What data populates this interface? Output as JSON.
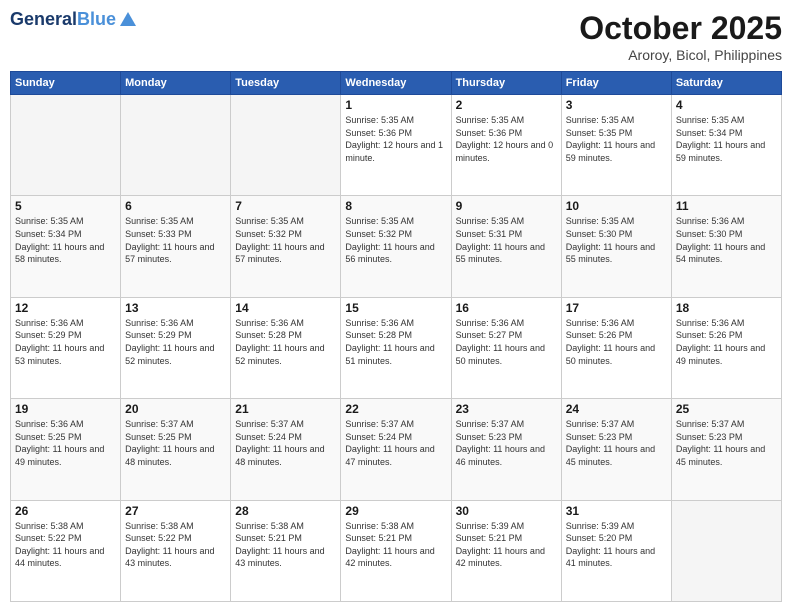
{
  "header": {
    "logo_line1": "General",
    "logo_line2": "Blue",
    "title": "October 2025",
    "subtitle": "Aroroy, Bicol, Philippines"
  },
  "calendar": {
    "days_of_week": [
      "Sunday",
      "Monday",
      "Tuesday",
      "Wednesday",
      "Thursday",
      "Friday",
      "Saturday"
    ],
    "weeks": [
      [
        {
          "day": "",
          "empty": true
        },
        {
          "day": "",
          "empty": true
        },
        {
          "day": "",
          "empty": true
        },
        {
          "day": "1",
          "sunrise": "5:35 AM",
          "sunset": "5:36 PM",
          "daylight": "12 hours and 1 minute."
        },
        {
          "day": "2",
          "sunrise": "5:35 AM",
          "sunset": "5:36 PM",
          "daylight": "12 hours and 0 minutes."
        },
        {
          "day": "3",
          "sunrise": "5:35 AM",
          "sunset": "5:35 PM",
          "daylight": "11 hours and 59 minutes."
        },
        {
          "day": "4",
          "sunrise": "5:35 AM",
          "sunset": "5:34 PM",
          "daylight": "11 hours and 59 minutes."
        }
      ],
      [
        {
          "day": "5",
          "sunrise": "5:35 AM",
          "sunset": "5:34 PM",
          "daylight": "11 hours and 58 minutes."
        },
        {
          "day": "6",
          "sunrise": "5:35 AM",
          "sunset": "5:33 PM",
          "daylight": "11 hours and 57 minutes."
        },
        {
          "day": "7",
          "sunrise": "5:35 AM",
          "sunset": "5:32 PM",
          "daylight": "11 hours and 57 minutes."
        },
        {
          "day": "8",
          "sunrise": "5:35 AM",
          "sunset": "5:32 PM",
          "daylight": "11 hours and 56 minutes."
        },
        {
          "day": "9",
          "sunrise": "5:35 AM",
          "sunset": "5:31 PM",
          "daylight": "11 hours and 55 minutes."
        },
        {
          "day": "10",
          "sunrise": "5:35 AM",
          "sunset": "5:30 PM",
          "daylight": "11 hours and 55 minutes."
        },
        {
          "day": "11",
          "sunrise": "5:36 AM",
          "sunset": "5:30 PM",
          "daylight": "11 hours and 54 minutes."
        }
      ],
      [
        {
          "day": "12",
          "sunrise": "5:36 AM",
          "sunset": "5:29 PM",
          "daylight": "11 hours and 53 minutes."
        },
        {
          "day": "13",
          "sunrise": "5:36 AM",
          "sunset": "5:29 PM",
          "daylight": "11 hours and 52 minutes."
        },
        {
          "day": "14",
          "sunrise": "5:36 AM",
          "sunset": "5:28 PM",
          "daylight": "11 hours and 52 minutes."
        },
        {
          "day": "15",
          "sunrise": "5:36 AM",
          "sunset": "5:28 PM",
          "daylight": "11 hours and 51 minutes."
        },
        {
          "day": "16",
          "sunrise": "5:36 AM",
          "sunset": "5:27 PM",
          "daylight": "11 hours and 50 minutes."
        },
        {
          "day": "17",
          "sunrise": "5:36 AM",
          "sunset": "5:26 PM",
          "daylight": "11 hours and 50 minutes."
        },
        {
          "day": "18",
          "sunrise": "5:36 AM",
          "sunset": "5:26 PM",
          "daylight": "11 hours and 49 minutes."
        }
      ],
      [
        {
          "day": "19",
          "sunrise": "5:36 AM",
          "sunset": "5:25 PM",
          "daylight": "11 hours and 49 minutes."
        },
        {
          "day": "20",
          "sunrise": "5:37 AM",
          "sunset": "5:25 PM",
          "daylight": "11 hours and 48 minutes."
        },
        {
          "day": "21",
          "sunrise": "5:37 AM",
          "sunset": "5:24 PM",
          "daylight": "11 hours and 48 minutes."
        },
        {
          "day": "22",
          "sunrise": "5:37 AM",
          "sunset": "5:24 PM",
          "daylight": "11 hours and 47 minutes."
        },
        {
          "day": "23",
          "sunrise": "5:37 AM",
          "sunset": "5:23 PM",
          "daylight": "11 hours and 46 minutes."
        },
        {
          "day": "24",
          "sunrise": "5:37 AM",
          "sunset": "5:23 PM",
          "daylight": "11 hours and 45 minutes."
        },
        {
          "day": "25",
          "sunrise": "5:37 AM",
          "sunset": "5:23 PM",
          "daylight": "11 hours and 45 minutes."
        }
      ],
      [
        {
          "day": "26",
          "sunrise": "5:38 AM",
          "sunset": "5:22 PM",
          "daylight": "11 hours and 44 minutes."
        },
        {
          "day": "27",
          "sunrise": "5:38 AM",
          "sunset": "5:22 PM",
          "daylight": "11 hours and 43 minutes."
        },
        {
          "day": "28",
          "sunrise": "5:38 AM",
          "sunset": "5:21 PM",
          "daylight": "11 hours and 43 minutes."
        },
        {
          "day": "29",
          "sunrise": "5:38 AM",
          "sunset": "5:21 PM",
          "daylight": "11 hours and 42 minutes."
        },
        {
          "day": "30",
          "sunrise": "5:39 AM",
          "sunset": "5:21 PM",
          "daylight": "11 hours and 42 minutes."
        },
        {
          "day": "31",
          "sunrise": "5:39 AM",
          "sunset": "5:20 PM",
          "daylight": "11 hours and 41 minutes."
        },
        {
          "day": "",
          "empty": true
        }
      ]
    ]
  }
}
